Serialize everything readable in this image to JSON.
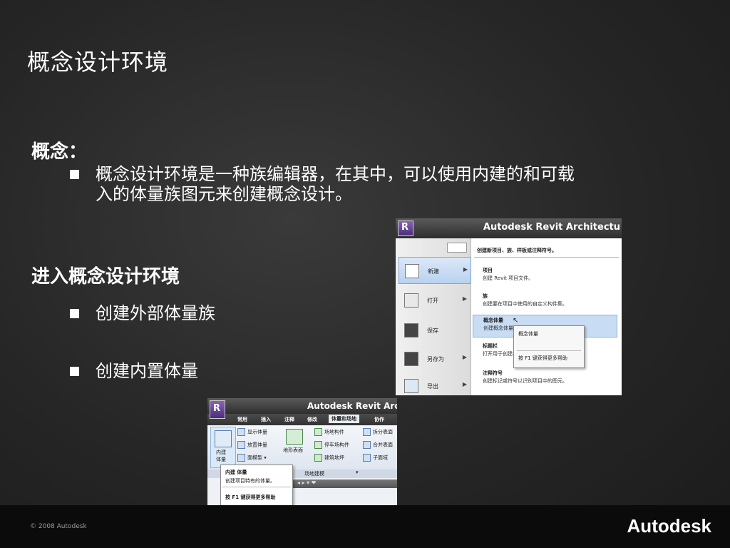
{
  "slide": {
    "title": "概念设计环境",
    "section1": {
      "heading": "概念：",
      "bullets": [
        "概念设计环境是一种族编辑器，在其中，可以使用内建的和可载",
        "入的体量族图元来创建概念设计。"
      ]
    },
    "section2": {
      "heading": "进入概念设计环境",
      "bullets": [
        "创建外部体量族",
        "创建内置体量"
      ]
    }
  },
  "screenshot1": {
    "app_button": "R",
    "window_title": "Autodesk Revit Architectu",
    "left_menu": [
      {
        "label": "新建",
        "icon": "new-document-icon",
        "has_submenu": true,
        "selected": true
      },
      {
        "label": "打开",
        "icon": "folder-open-icon",
        "has_submenu": true
      },
      {
        "label": "保存",
        "icon": "save-disk-icon",
        "has_submenu": false
      },
      {
        "label": "另存为",
        "icon": "save-as-icon",
        "has_submenu": true
      },
      {
        "label": "导出",
        "icon": "export-arrow-icon",
        "has_submenu": true
      }
    ],
    "right_header": "创建新项目、族、样板或注释符号。",
    "right_items": [
      {
        "title": "项目",
        "desc": "创建 Revit 项目文件。"
      },
      {
        "title": "族",
        "desc": "创建要在项目中使用的自定义构件集。"
      },
      {
        "title": "概念体量",
        "desc": "创建概念体量模型",
        "selected": true
      },
      {
        "title": "标题栏",
        "desc": "打开用于创建标题栏的样板。"
      },
      {
        "title": "注释符号",
        "desc": "创建标记或符号以识别项目中的图元。"
      }
    ],
    "tooltip": {
      "title": "概念体量",
      "help": "按 F1 键获得更多帮助"
    }
  },
  "screenshot2": {
    "app_button": "R",
    "window_title": "Autodesk Revit Arc",
    "tabs": [
      "常用",
      "插入",
      "注释",
      "修改",
      "体量和场地",
      "协作"
    ],
    "active_tab": "体量和场地",
    "ribbon": {
      "inplace_label_1": "内建",
      "inplace_label_2": "体量",
      "col1": [
        "显示体量",
        "放置体量",
        "面模型"
      ],
      "terrain": "地形表面",
      "col3": [
        "场地构件",
        "停车场构件",
        "建筑地坪"
      ],
      "col4": [
        "拆分表面",
        "合并表面",
        "子面域"
      ],
      "panel_label": "场地建模"
    },
    "dropdown": {
      "title": "内建 体量",
      "desc": "创建项目特有的体量。",
      "help": "按 F1 键获得更多帮助"
    }
  },
  "footer": {
    "copyright": "© 2008 Autodesk",
    "brand": "Autodesk"
  }
}
